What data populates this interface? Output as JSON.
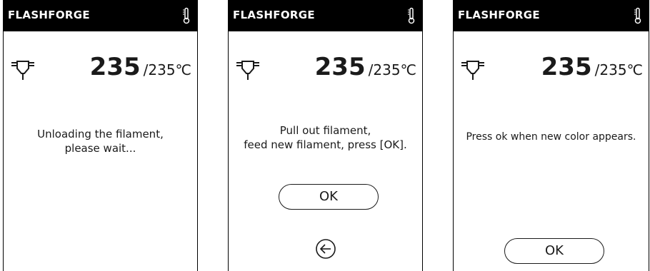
{
  "brand": "FLASHFORGE",
  "icons": {
    "thermometer": "thermometer-icon",
    "nozzle": "nozzle-icon",
    "back": "back-arrow-icon"
  },
  "temperature": {
    "current": "235",
    "target": "/235℃"
  },
  "screens": [
    {
      "message_lines": [
        "Unloading the filament,",
        "please wait..."
      ]
    },
    {
      "message_lines": [
        "Pull out filament,",
        "feed new filament, press [OK]."
      ],
      "ok_label": "OK"
    },
    {
      "message_lines": [
        "Press ok when new color appears."
      ],
      "ok_label": "OK"
    }
  ]
}
